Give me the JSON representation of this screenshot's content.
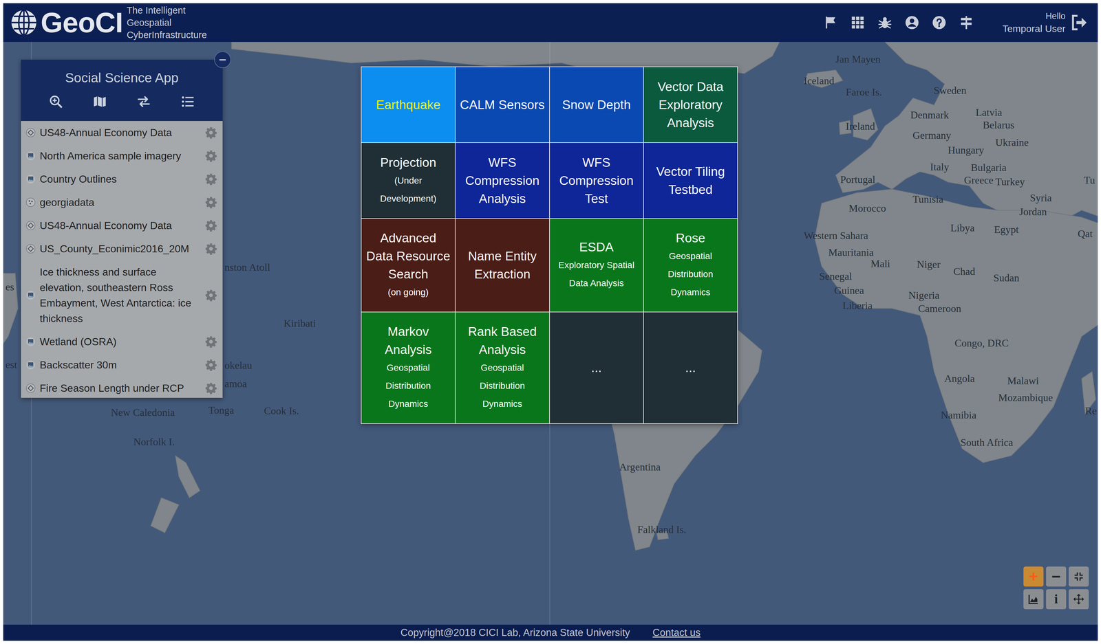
{
  "header": {
    "logo": "GeoCI",
    "tagline": [
      "The Intelligent",
      "Geospatial",
      "CyberInfrastructure"
    ],
    "greeting": "Hello",
    "user": "Temporal User"
  },
  "panel": {
    "title": "Social Science App",
    "collapse": "−",
    "layers": [
      {
        "name": "US48-Annual Economy Data",
        "kind": "vector"
      },
      {
        "name": "North America sample imagery",
        "kind": "raster"
      },
      {
        "name": "Country Outlines",
        "kind": "raster"
      },
      {
        "name": "georgiadata",
        "kind": "point"
      },
      {
        "name": "US48-Annual Economy Data",
        "kind": "vector"
      },
      {
        "name": "US_County_Econimic2016_20M",
        "kind": "vector"
      },
      {
        "name": "Ice thickness and surface elevation, southeastern Ross Embayment, West Antarctica: ice thickness",
        "kind": "raster"
      },
      {
        "name": "Wetland (OSRA)",
        "kind": "raster"
      },
      {
        "name": "Backscatter 30m",
        "kind": "raster"
      },
      {
        "name": "Fire Season Length under RCP",
        "kind": "vector"
      }
    ]
  },
  "apps": [
    {
      "title": "Earthquake",
      "color": "#0b8ef0",
      "selected": true
    },
    {
      "title": "CALM Sensors",
      "color": "#0a48b2",
      "selected": false
    },
    {
      "title": "Snow Depth",
      "color": "#0a48b2",
      "selected": false
    },
    {
      "title": "Vector Data Exploratory Analysis",
      "color": "#0b5a3e",
      "selected": false
    },
    {
      "title": "Projection",
      "subtitle": "(Under Development)",
      "color": "#1f2f35",
      "selected": false
    },
    {
      "title": "WFS Compression Analysis",
      "color": "#0f2698",
      "selected": false
    },
    {
      "title": "WFS Compression Test",
      "color": "#0f2698",
      "selected": false
    },
    {
      "title": "Vector Tiling Testbed",
      "color": "#0f2698",
      "selected": false
    },
    {
      "title": "Advanced Data Resource Search",
      "subtitle": "(on going)",
      "color": "#4b1d17",
      "selected": false
    },
    {
      "title": "Name Entity Extraction",
      "color": "#4b1d17",
      "selected": false
    },
    {
      "title": "ESDA",
      "subtitle": "Exploratory Spatial Data Analysis",
      "color": "#0a761c",
      "selected": false
    },
    {
      "title": "Rose",
      "subtitle": "Geospatial Distribution Dynamics",
      "color": "#0a761c",
      "selected": false
    },
    {
      "title": "Markov Analysis",
      "subtitle": "Geospatial Distribution Dynamics",
      "color": "#0a761c",
      "selected": false
    },
    {
      "title": "Rank Based Analysis",
      "subtitle": "Geospatial Distribution Dynamics",
      "color": "#0a761c",
      "selected": false
    },
    {
      "title": "...",
      "color": "#1f2f35",
      "selected": false
    },
    {
      "title": "...",
      "color": "#1f2f35",
      "selected": false
    }
  ],
  "map_labels": [
    "Jan Mayen",
    "Iceland",
    "Faroe Is.",
    "Sweden",
    "Denmark",
    "Latvia",
    "Belarus",
    "Ireland",
    "Germany",
    "Ukraine",
    "Hungary",
    "Italy",
    "Bulgaria",
    "Portugal",
    "Greece",
    "Turkey",
    "Tu",
    "Tunisia",
    "Syria",
    "Morocco",
    "Jordan",
    "Libya",
    "Egypt",
    "Qat",
    "Western Sahara",
    "Mauritania",
    "Mali",
    "Niger",
    "Chad",
    "Sudan",
    "Senegal",
    "Guinea",
    "Liberia",
    "Nigeria",
    "Cameroon",
    "Congo, DRC",
    "Angola",
    "Malawi",
    "Mozambique",
    "Namibia",
    "South Africa",
    "Argentina",
    "Falkland Is.",
    "New Caledonia",
    "Tonga",
    "Cook Is.",
    "Norfolk I.",
    "Kiribati",
    "nston Atoll",
    "okelau",
    "amoa",
    "Re",
    "es",
    "est"
  ],
  "map_controls": {
    "zoom_in": "+",
    "zoom_out": "−",
    "info": "i"
  },
  "footer": {
    "copyright": "Copyright@2018 CICI Lab, Arizona State University",
    "contact": "Contact us"
  }
}
